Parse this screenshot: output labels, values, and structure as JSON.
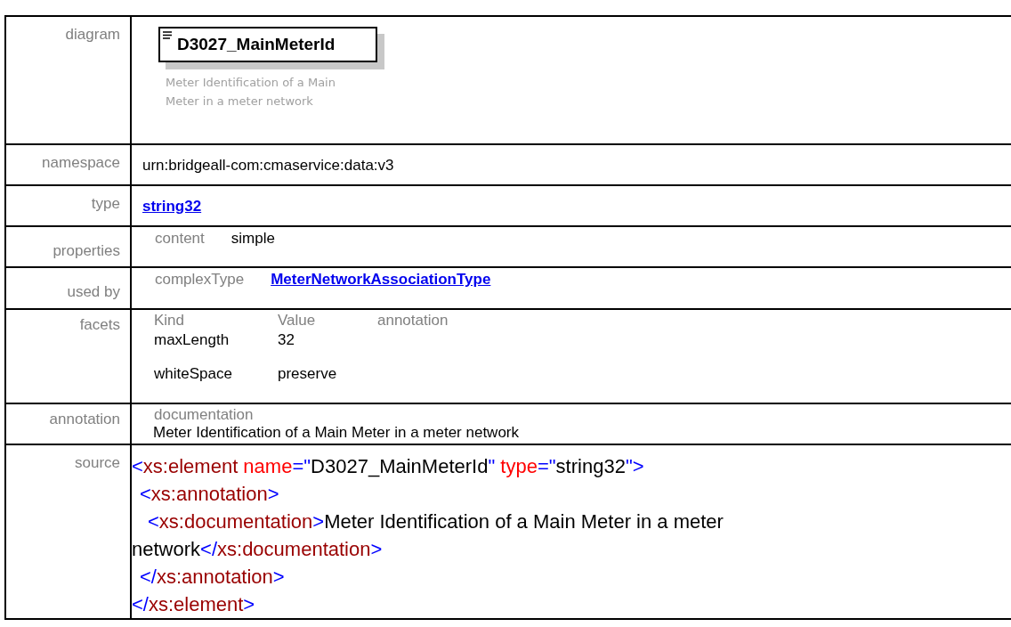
{
  "diagram": {
    "label": "diagram",
    "element_name": "D3027_MainMeterId",
    "description": "Meter Identification of a Main Meter in a meter network"
  },
  "namespace": {
    "label": "namespace",
    "value": "urn:bridgeall-com:cmaservice:data:v3"
  },
  "type": {
    "label": "type",
    "link": "string32"
  },
  "properties": {
    "label": "properties",
    "key": "content",
    "value": "simple"
  },
  "used_by": {
    "label": "used by",
    "key": "complexType",
    "link": "MeterNetworkAssociationType"
  },
  "facets": {
    "label": "facets",
    "columns": [
      "Kind",
      "Value",
      "annotation"
    ],
    "rows": [
      {
        "kind": "maxLength",
        "value": "32"
      },
      {
        "kind": "whiteSpace",
        "value": "preserve"
      }
    ]
  },
  "annotation": {
    "label": "annotation",
    "key": "documentation",
    "text": "Meter Identification of a Main Meter in a meter network"
  },
  "source": {
    "label": "source",
    "nodes": [
      {
        "open": [
          {
            "kind": "punct",
            "text": "<"
          },
          {
            "kind": "tag",
            "text": "xs:element"
          },
          {
            "kind": "attr",
            "text": " name"
          },
          {
            "kind": "punct",
            "text": "=\""
          },
          {
            "kind": "text",
            "text": "D3027_MainMeterId"
          },
          {
            "kind": "punct",
            "text": "\""
          },
          {
            "kind": "attr",
            "text": " type"
          },
          {
            "kind": "punct",
            "text": "=\""
          },
          {
            "kind": "text",
            "text": "string32"
          },
          {
            "kind": "punct",
            "text": "\">"
          }
        ],
        "children": [
          {
            "open": [
              {
                "kind": "punct",
                "text": "<"
              },
              {
                "kind": "tag",
                "text": "xs:annotation"
              },
              {
                "kind": "punct",
                "text": ">"
              }
            ],
            "children": [
              {
                "open": [
                  {
                    "kind": "punct",
                    "text": "<"
                  },
                  {
                    "kind": "tag",
                    "text": "xs:documentation"
                  },
                  {
                    "kind": "punct",
                    "text": ">"
                  },
                  {
                    "kind": "text",
                    "text": "Meter Identification of a Main Meter in a meter network"
                  },
                  {
                    "kind": "punct",
                    "text": "</"
                  },
                  {
                    "kind": "tag",
                    "text": "xs:documentation"
                  },
                  {
                    "kind": "punct",
                    "text": ">"
                  }
                ]
              }
            ],
            "close": [
              {
                "kind": "punct",
                "text": "</"
              },
              {
                "kind": "tag",
                "text": "xs:annotation"
              },
              {
                "kind": "punct",
                "text": ">"
              }
            ]
          }
        ],
        "close": [
          {
            "kind": "punct",
            "text": "</"
          },
          {
            "kind": "tag",
            "text": "xs:element"
          },
          {
            "kind": "punct",
            "text": ">"
          }
        ]
      }
    ]
  }
}
